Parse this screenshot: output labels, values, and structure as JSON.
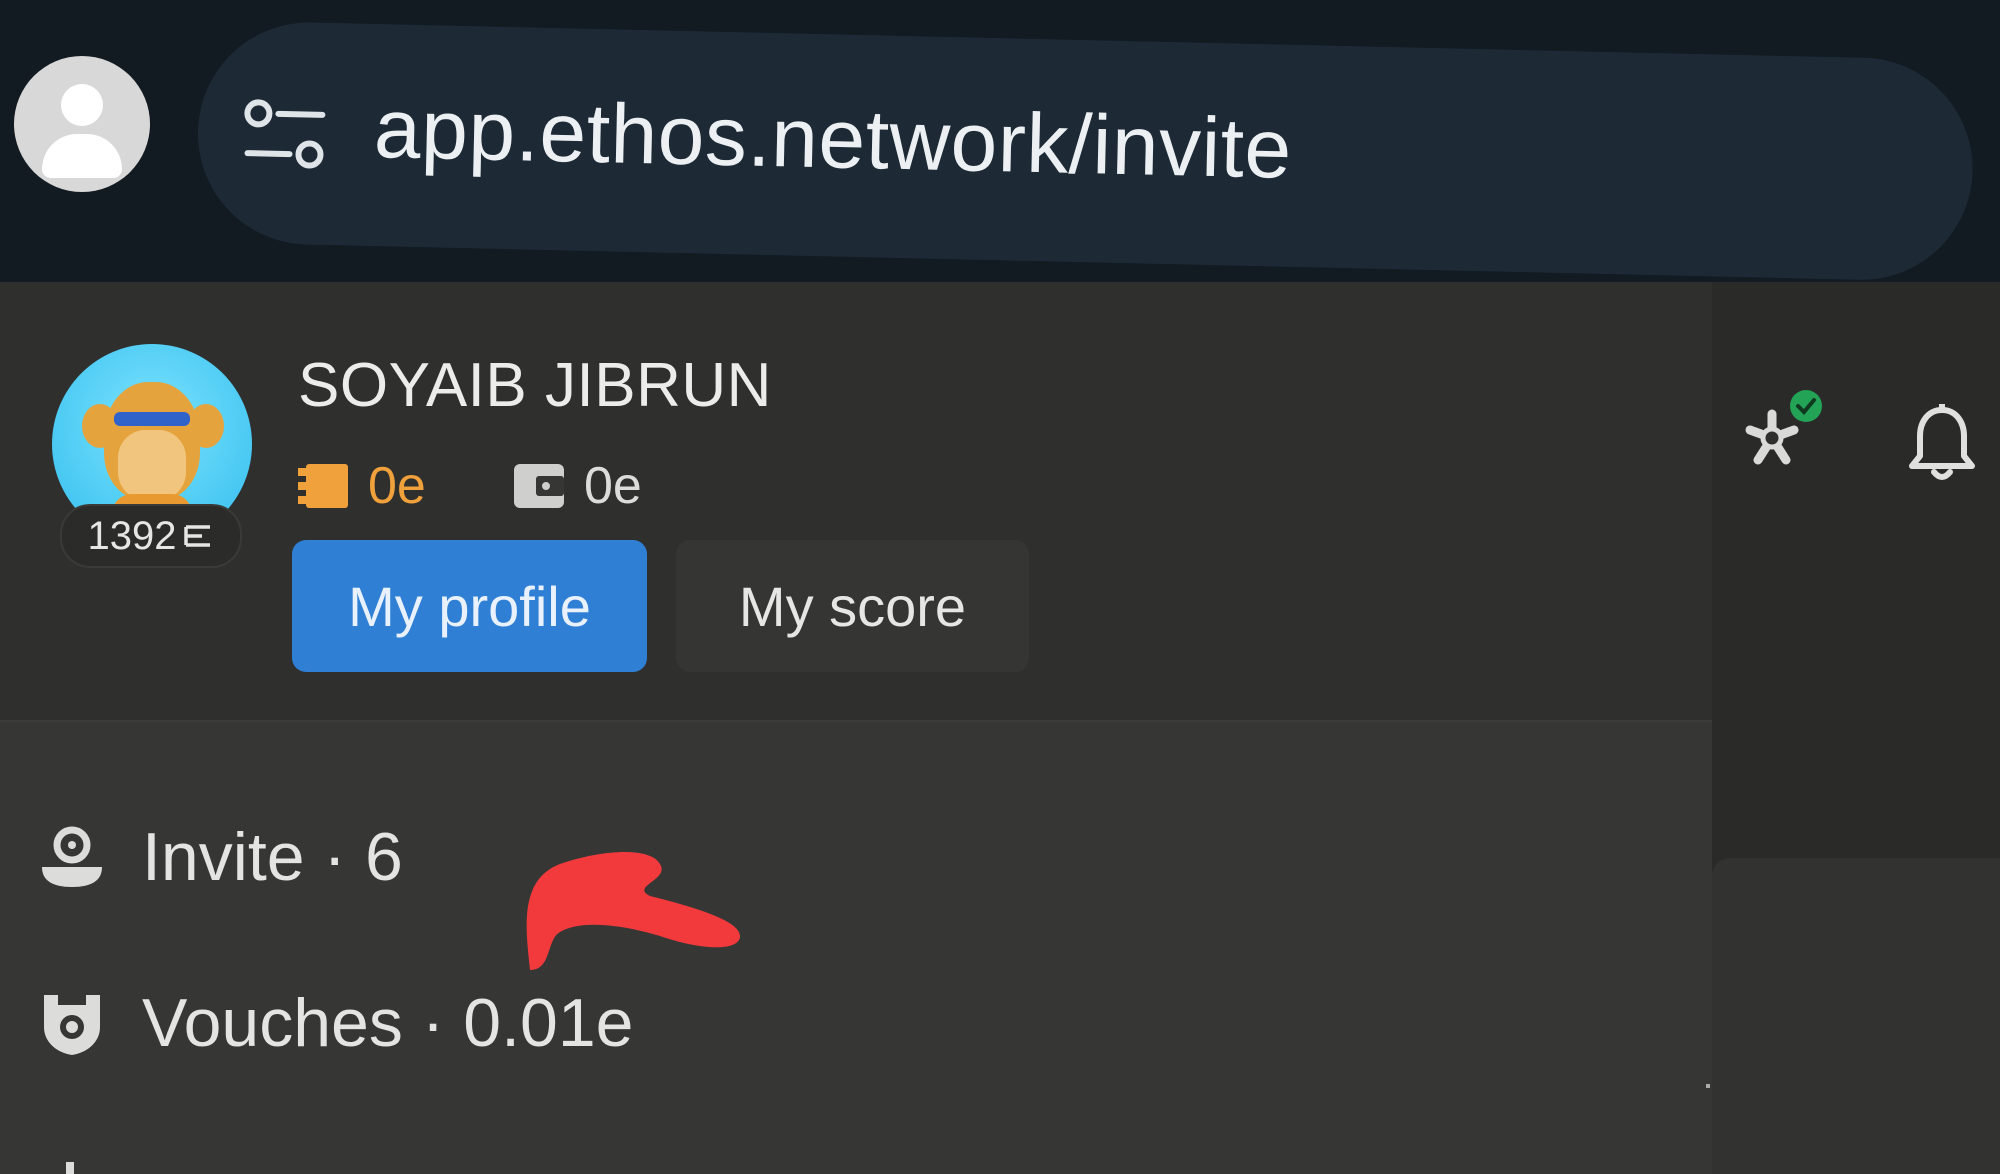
{
  "browser": {
    "url": "app.ethos.network/invite"
  },
  "profile": {
    "name": "SOYAIB JIBRUN",
    "score": "1392",
    "balance_primary": "0e",
    "balance_wallet": "0e",
    "my_profile_label": "My profile",
    "my_score_label": "My score"
  },
  "menu": {
    "items": [
      {
        "label": "Invite · 6",
        "icon": "invite-icon"
      },
      {
        "label": "Vouches · 0.01e",
        "icon": "vouch-shield-icon"
      }
    ]
  },
  "colors": {
    "accent": "#2f7fd5",
    "balance_orange": "#f0a13c",
    "status_green": "#22a355",
    "annotation_red": "#f23a3d"
  }
}
